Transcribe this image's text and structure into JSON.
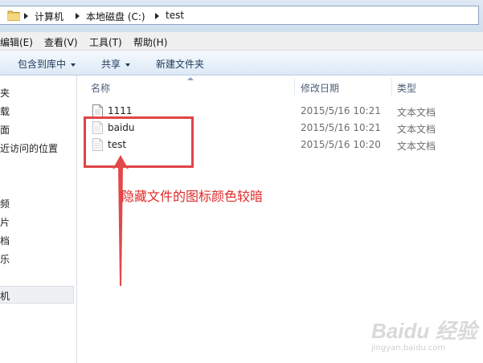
{
  "address": {
    "crumbs": [
      "计算机",
      "本地磁盘 (C:)",
      "test"
    ]
  },
  "menubar": {
    "items": [
      "编辑(E)",
      "查看(V)",
      "工具(T)",
      "帮助(H)"
    ]
  },
  "toolbar": {
    "include_label": "包含到库中",
    "share_label": "共享",
    "new_folder_label": "新建文件夹"
  },
  "nav": {
    "items": [
      "夹",
      "载",
      "面",
      "近访问的位置",
      "频",
      "片",
      "档",
      "乐",
      "机"
    ]
  },
  "columns": {
    "name": "名称",
    "modified": "修改日期",
    "type": "类型"
  },
  "files": [
    {
      "name": "1111",
      "modified": "2015/5/16 10:21",
      "type": "文本文档",
      "hidden": false
    },
    {
      "name": "baidu",
      "modified": "2015/5/16 10:21",
      "type": "文本文档",
      "hidden": true
    },
    {
      "name": "test",
      "modified": "2015/5/16 10:20",
      "type": "文本文档",
      "hidden": true
    }
  ],
  "annotation": {
    "text": "隐藏文件的图标颜色较暗",
    "color": "#e02a2a"
  },
  "watermark": {
    "main": "Baidu 经验",
    "sub": "jingyan.baidu.com"
  }
}
